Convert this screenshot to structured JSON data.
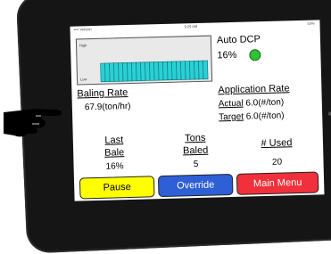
{
  "status_bar": {
    "carrier": "•••• Verizon",
    "time": "9:29 AM",
    "battery": "53%"
  },
  "chart": {
    "ylabel_top": "High",
    "ylabel_bottom": "Low",
    "bar_level": 0.45,
    "colors": {
      "bars": "#2ad0d6",
      "bar_outline": "#0a6f75",
      "background": "#e9e9e9"
    }
  },
  "auto_mode": {
    "label": "Auto",
    "indicator_label": "DCP",
    "percent": "16",
    "percent_unit": "%",
    "indicator_color": "#2ec234"
  },
  "baling_rate": {
    "title": "Baling Rate",
    "value": "67.9",
    "unit": "(ton/hr)"
  },
  "application_rate": {
    "title": "Application Rate",
    "actual": {
      "label": "Actual",
      "value": "6.0",
      "unit": "(#/ton)"
    },
    "target": {
      "label": "Target",
      "value": "6.0",
      "unit": "(#/ton)"
    }
  },
  "stats": {
    "last_bale": {
      "label_line1": "Last",
      "label_line2": "Bale",
      "value": "16",
      "unit": "%"
    },
    "tons_baled": {
      "label_line1": "Tons",
      "label_line2": "Baled",
      "value": "5"
    },
    "used": {
      "label": "# Used",
      "value": "20"
    }
  },
  "buttons": {
    "pause": {
      "label": "Pause",
      "color": "#ffff00"
    },
    "override": {
      "label": "Override",
      "color": "#2e5fd6"
    },
    "main_menu": {
      "label": "Main Menu",
      "color": "#f0303a"
    }
  }
}
